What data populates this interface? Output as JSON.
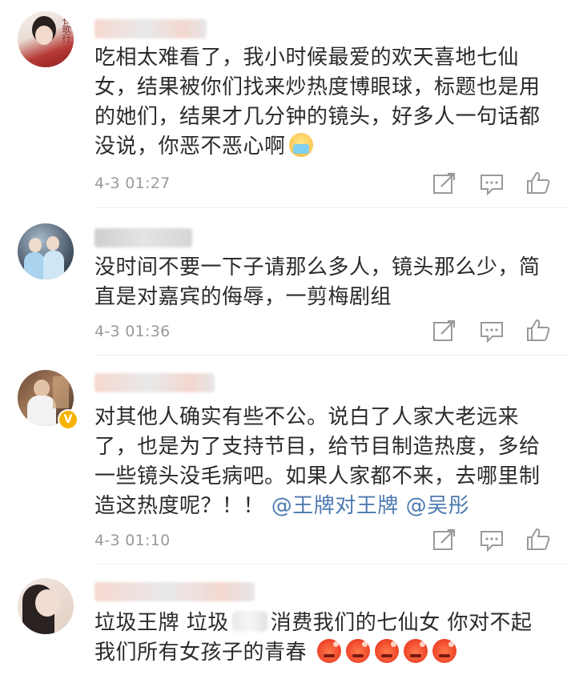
{
  "comments": [
    {
      "text": "吃相太难看了，我小时候最爱的欢天喜地七仙女，结果被你们找来炒热度博眼球，标题也是用的她们，结果才几分钟的镜头，好多人一句话都没说，你恶不恶心啊",
      "emoji": "crying-emoji",
      "time": "4-3 01:27",
      "avatar_text": "长歌行"
    },
    {
      "text": "没时间不要一下子请那么多人，镜头那么少，简直是对嘉宾的侮辱，一剪梅剧组",
      "time": "4-3 01:36"
    },
    {
      "text": "对其他人确实有些不公。说白了人家大老远来了，也是为了支持节目，给节目制造热度，多给一些镜头没毛病吧。如果人家都不来，去哪里制造这热度呢？！！",
      "mention1": "@王牌对王牌",
      "mention2": "@吴彤",
      "time": "4-3 01:10",
      "verified": "V"
    },
    {
      "text_part1": "垃圾王牌 垃圾",
      "text_part2": "消费我们的七仙女 你对不起我们所有女孩子的青春",
      "emoji": "angry-emoji"
    }
  ],
  "icons": {
    "repost": "repost-icon",
    "comment": "comment-icon",
    "like": "thumbs-up-icon"
  },
  "colors": {
    "mention": "#4d7ab0",
    "timestamp": "#9a9a9a",
    "text": "#2b2b2b"
  }
}
